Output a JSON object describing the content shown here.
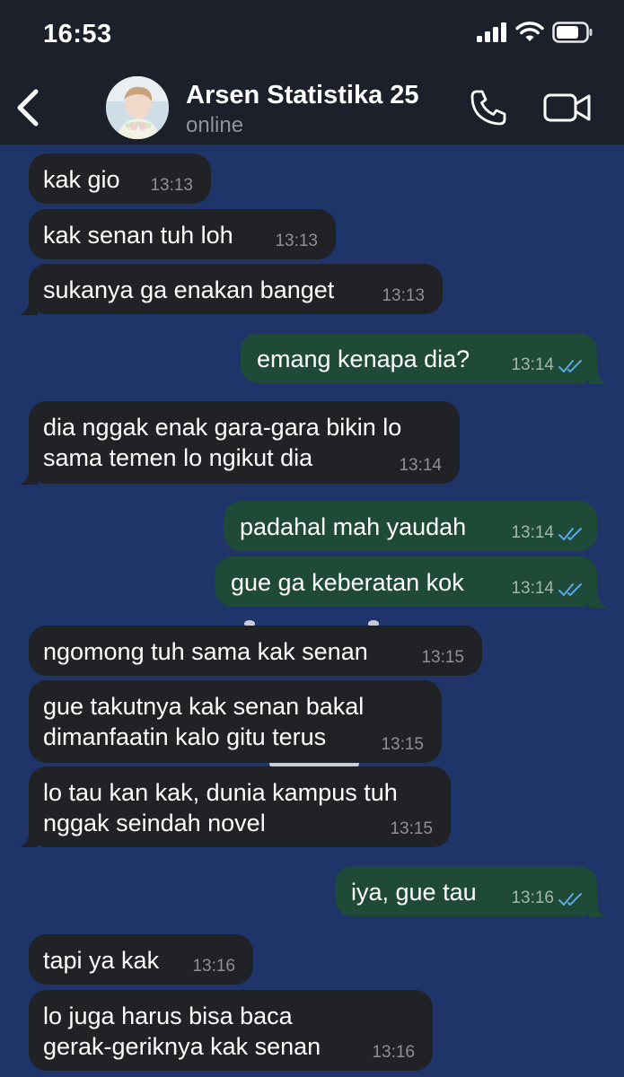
{
  "status_bar": {
    "time": "16:53"
  },
  "header": {
    "contact_name": "Arsen Statistika 25",
    "contact_status": "online"
  },
  "icons": {
    "back": "chevron-left-icon",
    "call": "phone-icon",
    "video": "video-camera-icon",
    "read_receipt": "double-check-icon"
  },
  "colors": {
    "header_bg": "#1c202a",
    "chat_bg": "#1f3569",
    "incoming_bubble": "#212226",
    "outgoing_bubble": "#1f4a37",
    "read_check": "#5aa7e8"
  },
  "messages": [
    {
      "dir": "in",
      "text": "kak gio",
      "time": "13:13"
    },
    {
      "dir": "in",
      "text": "kak senan tuh loh",
      "time": "13:13"
    },
    {
      "dir": "in",
      "text": "sukanya ga enakan banget",
      "time": "13:13"
    },
    {
      "dir": "out",
      "text": "emang kenapa dia?",
      "time": "13:14"
    },
    {
      "dir": "in",
      "text": "dia nggak enak gara-gara bikin lo\nsama temen lo ngikut dia",
      "time": "13:14"
    },
    {
      "dir": "out",
      "text": "padahal mah yaudah",
      "time": "13:14"
    },
    {
      "dir": "out",
      "text": "gue ga keberatan kok",
      "time": "13:14"
    },
    {
      "dir": "in",
      "text": "ngomong tuh sama kak senan",
      "time": "13:15"
    },
    {
      "dir": "in",
      "text": "gue takutnya kak senan bakal\ndimanfaatin kalo gitu terus",
      "time": "13:15"
    },
    {
      "dir": "in",
      "text": "lo tau kan kak, dunia kampus tuh\nnggak seindah novel",
      "time": "13:15"
    },
    {
      "dir": "out",
      "text": "iya, gue tau",
      "time": "13:16"
    },
    {
      "dir": "in",
      "text": "tapi ya kak",
      "time": "13:16"
    },
    {
      "dir": "in",
      "text": "lo juga harus bisa baca\ngerak-geriknya kak senan",
      "time": "13:16"
    }
  ]
}
